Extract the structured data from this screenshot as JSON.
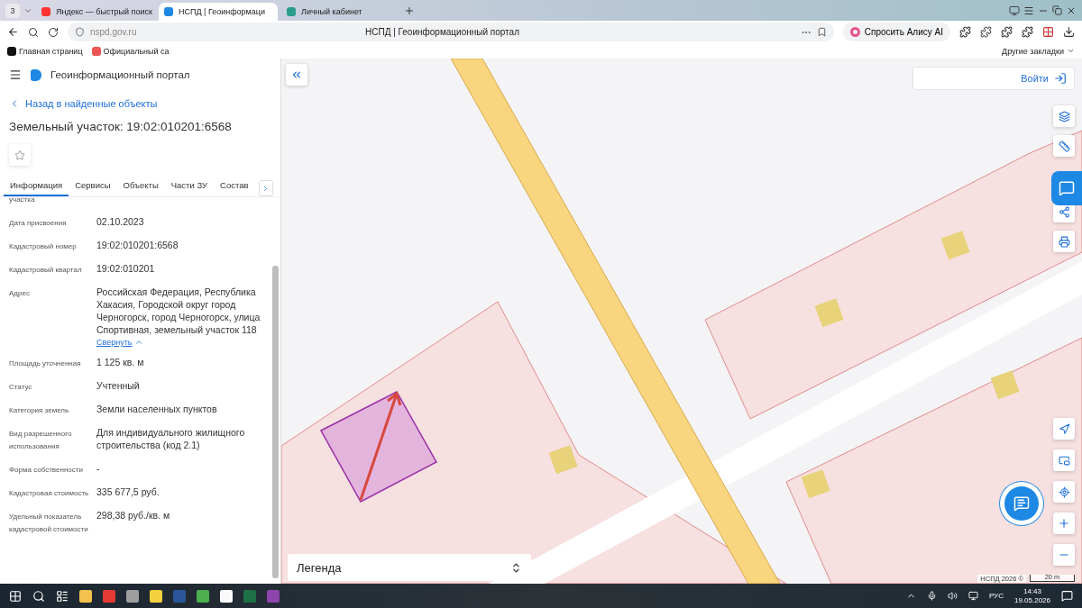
{
  "browser": {
    "tab_count": "3",
    "tabs": [
      {
        "title": "Яндекс — быстрый поиск",
        "selected": false
      },
      {
        "title": "НСПД | Геоинформаци",
        "selected": true
      },
      {
        "title": "Личный кабинет",
        "selected": false
      }
    ],
    "url": "nspd.gov.ru",
    "page_title": "НСПД | Геоинформационный портал",
    "alice_button": "Спросить Алису AI",
    "bookmarks": [
      "Главная страниц",
      "Официальный са"
    ],
    "other_bookmarks": "Другие закладки"
  },
  "panel": {
    "brand": "Геоинформационный портал",
    "back_link": "Назад в найденные объекты",
    "title": "Земельный участок: 19:02:010201:6568",
    "tabs": [
      {
        "label": "Информация",
        "selected": true
      },
      {
        "label": "Сервисы",
        "selected": false
      },
      {
        "label": "Объекты",
        "selected": false
      },
      {
        "label": "Части ЗУ",
        "selected": false
      },
      {
        "label": "Состав",
        "selected": false
      }
    ],
    "cut_label": "участка",
    "rows": [
      {
        "label": "Дата присвоения",
        "value": "02.10.2023"
      },
      {
        "label": "Кадастровый номер",
        "value": "19:02:010201:6568"
      },
      {
        "label": "Кадастровый квартал",
        "value": "19:02:010201"
      },
      {
        "label": "Адрес",
        "value": "Российская Федерация, Республика Хакасия, Городской округ город Черногорск, город Черногорск, улица Спортивная, земельный участок 118",
        "link": "Свернуть"
      },
      {
        "label": "Площадь уточненная",
        "value": "1 125 кв. м"
      },
      {
        "label": "Статус",
        "value": "Учтенный"
      },
      {
        "label": "Категория земель",
        "value": "Земли населенных пунктов"
      },
      {
        "label": "Вид разрешенного использования",
        "value": "Для индивидуального жилищного строительства (код 2.1)"
      },
      {
        "label": "Форма собственности",
        "value": "-"
      },
      {
        "label": "Кадастровая стоимость",
        "value": "335 677,5 руб."
      },
      {
        "label": "Удельный показатель кадастровой стоимости",
        "value": "298,38 руб./кв. м"
      }
    ]
  },
  "map": {
    "login": "Войти",
    "legend": "Легенда",
    "attribution": "НСПД 2026 ©",
    "scale": "20 m"
  },
  "taskbar": {
    "language": "РУС",
    "time": "14:43",
    "date": "19.05.2026"
  }
}
